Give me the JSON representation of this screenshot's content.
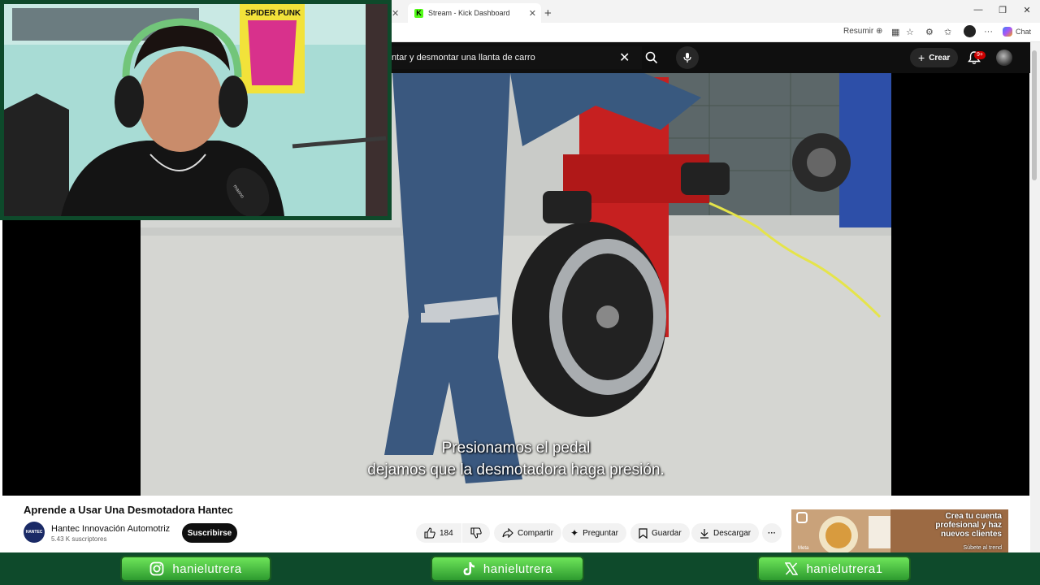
{
  "browser": {
    "tabs": [
      {
        "label": "Stream - Kick Dashboard"
      }
    ],
    "toolbar": {
      "resumir": "Resumir",
      "chat": "Chat"
    }
  },
  "youtube": {
    "search_value": "ntar y desmontar una llanta de carro",
    "create_label": "Crear",
    "notif_badge": "9+"
  },
  "video": {
    "caption_line1": "Presionamos el pedal",
    "caption_line2": "dejamos que la desmotadora haga presión.",
    "title": "Aprende a Usar Una Desmotadora Hantec",
    "channel": {
      "name": "Hantec Innovación Automotriz",
      "subscribers": "5.43 K suscriptores",
      "avatar_text": "HANTEC"
    },
    "subscribe_label": "Suscribirse",
    "likes": "184",
    "actions": {
      "share": "Compartir",
      "ask": "Preguntar",
      "save": "Guardar",
      "download": "Descargar"
    }
  },
  "ad": {
    "headline": "Crea tu cuenta profesional y haz nuevos clientes",
    "link": "Súbete al trend",
    "brand": "Meta"
  },
  "webcam": {
    "poster_text": "SPIDER PUNK",
    "mic_text": "maono"
  },
  "social": [
    {
      "icon": "instagram-icon",
      "handle": "hanielutrera"
    },
    {
      "icon": "tiktok-icon",
      "handle": "hanielutrera"
    },
    {
      "icon": "x-icon",
      "handle": "hanielutrera1"
    }
  ],
  "colors": {
    "accent_green": "#0e4a2b",
    "kick_green": "#53fc18",
    "yt_red": "#cc0000"
  }
}
